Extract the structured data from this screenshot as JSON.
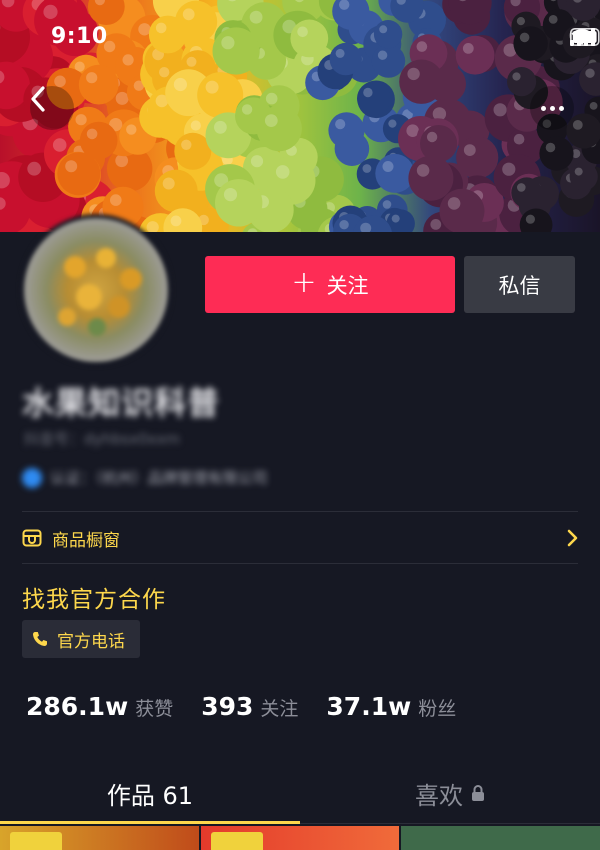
{
  "status_bar": {
    "time": "9:10"
  },
  "header": {
    "back_icon": "chevron-left-icon",
    "more_icon": "more-dots-icon"
  },
  "profile": {
    "nickname": "水果知识科普",
    "account_id": "抖音号：dyhbsx0xxm",
    "verified_text": "认证：（杭州）品牌管理有限公司",
    "follow_button": "关注",
    "message_button": "私信"
  },
  "shop": {
    "label": "商品橱窗",
    "icon": "shop-window-icon"
  },
  "cooperation": {
    "title": "找我官方合作",
    "phone_label": "官方电话",
    "phone_icon": "phone-icon"
  },
  "stats": [
    {
      "value": "286.1w",
      "label": "获赞"
    },
    {
      "value": "393",
      "label": "关注"
    },
    {
      "value": "37.1w",
      "label": "粉丝"
    }
  ],
  "tabs": {
    "works_label": "作品 61",
    "likes_label": "喜欢",
    "likes_icon": "lock-icon"
  },
  "colors": {
    "background": "#161823",
    "follow_button": "#fe2c55",
    "accent_yellow": "#fdd74c",
    "secondary_button": "#393b44"
  }
}
